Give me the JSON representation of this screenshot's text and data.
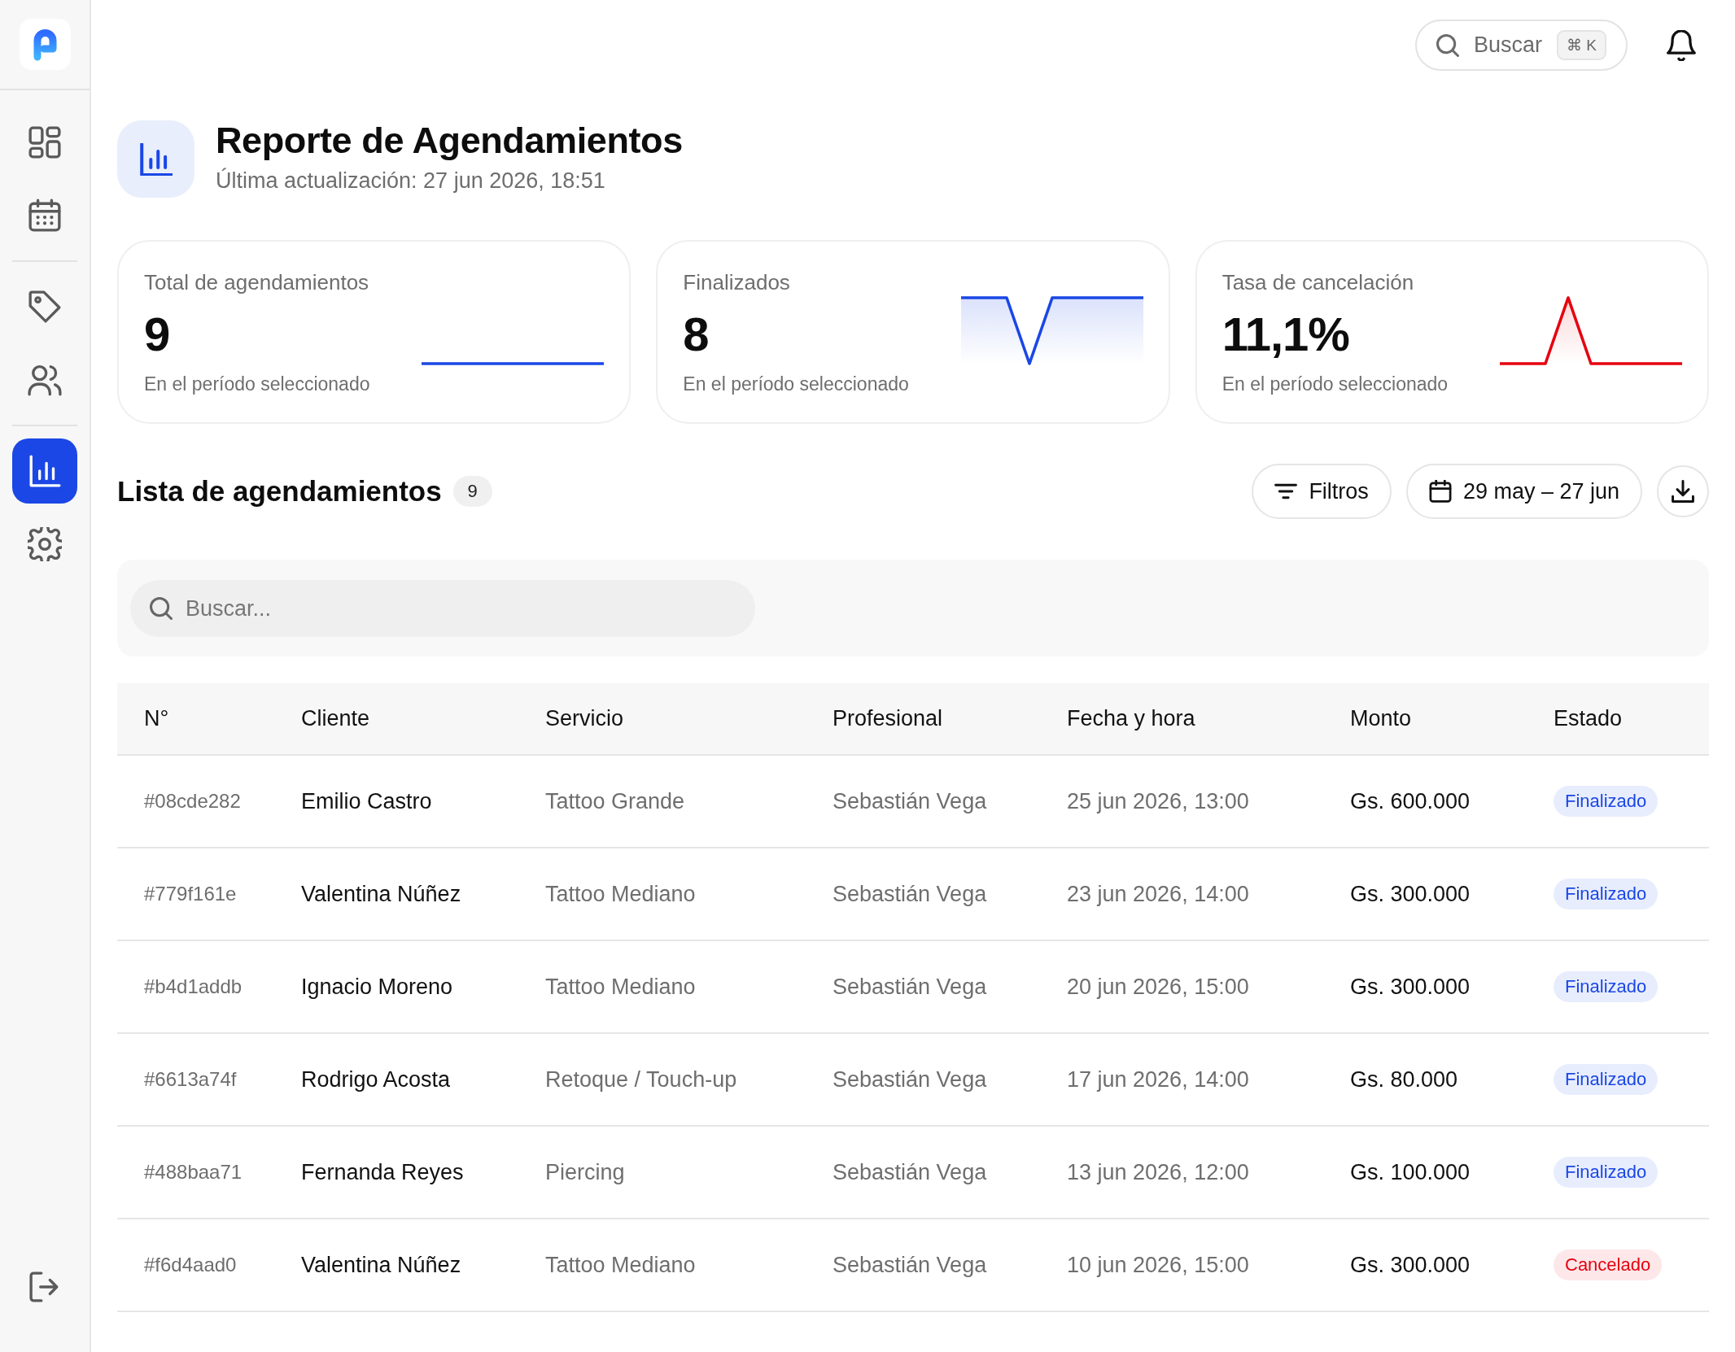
{
  "sidebar": {
    "groups": [
      {
        "items": [
          {
            "selected": false
          },
          {
            "selected": false
          }
        ]
      },
      {
        "items": [
          {
            "selected": false
          },
          {
            "selected": false
          }
        ]
      },
      {
        "items": [
          {
            "selected": true
          },
          {
            "selected": false
          }
        ]
      }
    ]
  },
  "topbar": {
    "search": {
      "label": "Buscar",
      "shortcut": "⌘ K"
    }
  },
  "header": {
    "title": "Reporte de Agendamientos",
    "subtitle": "Última actualización: 27 jun 2026, 18:51"
  },
  "stats": [
    {
      "label": "Total de agendamientos",
      "value": "9",
      "caption": "En el período seleccionado",
      "kind": "flat",
      "color": "#1a47e5"
    },
    {
      "label": "Finalizados",
      "value": "8",
      "caption": "En el período seleccionado",
      "kind": "dip",
      "color": "#1a47e5"
    },
    {
      "label": "Tasa de cancelación",
      "value": "11,1%",
      "caption": "En el período seleccionado",
      "kind": "peak",
      "color": "#e5000f"
    }
  ],
  "list": {
    "title": "Lista de agendamientos",
    "count": "9",
    "filters_button": "Filtros",
    "date_range": "29 may – 27 jun",
    "search": {
      "placeholder": "Buscar..."
    }
  },
  "table": {
    "columns": [
      "N°",
      "Cliente",
      "Servicio",
      "Profesional",
      "Fecha y hora",
      "Monto",
      "Estado"
    ],
    "rows": [
      {
        "id": "#08cde282",
        "client": "Emilio Castro",
        "service": "Tattoo Grande",
        "professional": "Sebastián Vega",
        "datetime": "25 jun 2026, 13:00",
        "amount": "Gs. 600.000",
        "status": {
          "label": "Finalizado",
          "kind": "done"
        }
      },
      {
        "id": "#779f161e",
        "client": "Valentina Núñez",
        "service": "Tattoo Mediano",
        "professional": "Sebastián Vega",
        "datetime": "23 jun 2026, 14:00",
        "amount": "Gs. 300.000",
        "status": {
          "label": "Finalizado",
          "kind": "done"
        }
      },
      {
        "id": "#b4d1addb",
        "client": "Ignacio Moreno",
        "service": "Tattoo Mediano",
        "professional": "Sebastián Vega",
        "datetime": "20 jun 2026, 15:00",
        "amount": "Gs. 300.000",
        "status": {
          "label": "Finalizado",
          "kind": "done"
        }
      },
      {
        "id": "#6613a74f",
        "client": "Rodrigo Acosta",
        "service": "Retoque / Touch-up",
        "professional": "Sebastián Vega",
        "datetime": "17 jun 2026, 14:00",
        "amount": "Gs. 80.000",
        "status": {
          "label": "Finalizado",
          "kind": "done"
        }
      },
      {
        "id": "#488baa71",
        "client": "Fernanda Reyes",
        "service": "Piercing",
        "professional": "Sebastián Vega",
        "datetime": "13 jun 2026, 12:00",
        "amount": "Gs. 100.000",
        "status": {
          "label": "Finalizado",
          "kind": "done"
        }
      },
      {
        "id": "#f6d4aad0",
        "client": "Valentina Núñez",
        "service": "Tattoo Mediano",
        "professional": "Sebastián Vega",
        "datetime": "10 jun 2026, 15:00",
        "amount": "Gs. 300.000",
        "status": {
          "label": "Cancelado",
          "kind": "cancelled"
        }
      }
    ]
  }
}
